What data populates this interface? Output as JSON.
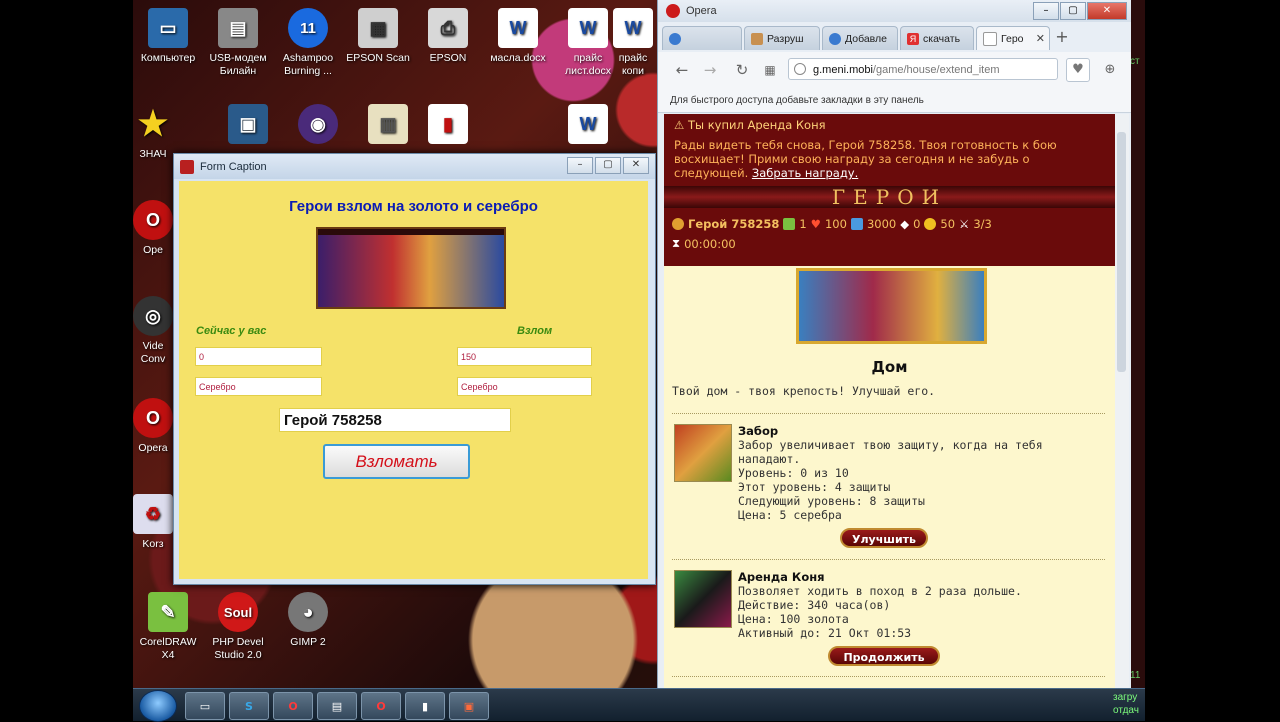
{
  "desktop": {
    "icons": [
      {
        "label": "Компьютер",
        "line2": ""
      },
      {
        "label": "USB-модем",
        "line2": "Билайн"
      },
      {
        "label": "Ashampoo",
        "line2": "Burning ..."
      },
      {
        "label": "EPSON Scan",
        "line2": ""
      },
      {
        "label": "EPSON",
        "line2": ""
      },
      {
        "label": "масла.docx",
        "line2": ""
      },
      {
        "label": "прайс",
        "line2": "лист.docx"
      },
      {
        "label": "прайс",
        "line2": "копи"
      },
      {
        "label": "ЗНАЧ",
        "line2": ""
      },
      {
        "label": "Ope",
        "line2": ""
      },
      {
        "label": "Vide",
        "line2": "Conv"
      },
      {
        "label": "Opera",
        "line2": ""
      },
      {
        "label": "Korз",
        "line2": ""
      },
      {
        "label": "CorelDRAW",
        "line2": "X4"
      },
      {
        "label": "PHP Devel",
        "line2": "Studio 2.0"
      },
      {
        "label": "GIMP 2",
        "line2": ""
      }
    ],
    "badge_number": "11",
    "soul_label": "Soul",
    "tray_line1": "загру",
    "tray_line2": "отдач",
    "right_edge_text1": "ст",
    "right_edge_text2": "11"
  },
  "form": {
    "title": "Form Caption",
    "heading": "Герои взлом на золото и серебро",
    "label_have": "Сейчас у вас",
    "label_hack": "Взлом",
    "have_amount": "0",
    "hack_amount": "150",
    "have_currency": "Серебро",
    "hack_currency": "Серебро",
    "hero_name": "Герой 758258",
    "hack_button": "Взломать"
  },
  "browser": {
    "app_name": "Opera",
    "tabs": [
      {
        "label": "Разруш"
      },
      {
        "label": "Добавле"
      },
      {
        "label": "скачать"
      },
      {
        "label": "Геро"
      }
    ],
    "url_host": "g.meni.mobi",
    "url_path": "/game/house/extend_item",
    "bookmarks_hint": "Для быстрого доступа добавьте закладки в эту панель"
  },
  "game": {
    "notice_title": "Ты купил Аренда Коня",
    "notice_text": "Рады видеть тебя снова, Герой 758258. Твоя готовность к бою восхищает! Прими свою награду за сегодня и не забудь о следующей.",
    "notice_link": "Забрать награду.",
    "logo": "ГЕРОИ",
    "stats": {
      "hero": "Герой 758258",
      "level": "1",
      "health": "100",
      "silver": "3000",
      "gems": "0",
      "gold": "50",
      "fights": "3/3",
      "timer": "00:00:00"
    },
    "page_title": "Дом",
    "intro": "Твой дом - твоя крепость! Улучшай его.",
    "items": [
      {
        "name": "Забор",
        "lines": [
          "Забор увеличивает твою защиту, когда на тебя",
          "нападают.",
          "Уровень: 0 из 10",
          "Этот уровень: 4 защиты",
          "Следующий уровень: 8 защиты",
          "Цена: 5 серебра"
        ],
        "button": "Улучшить"
      },
      {
        "name": "Аренда Коня",
        "lines": [
          "Позволяет ходить в поход в 2 раза дольше.",
          "Действие: 340 часа(ов)",
          "Цена: 100 золота",
          "Активный до: 21 Окт 01:53"
        ],
        "button": "Продолжить"
      }
    ]
  }
}
